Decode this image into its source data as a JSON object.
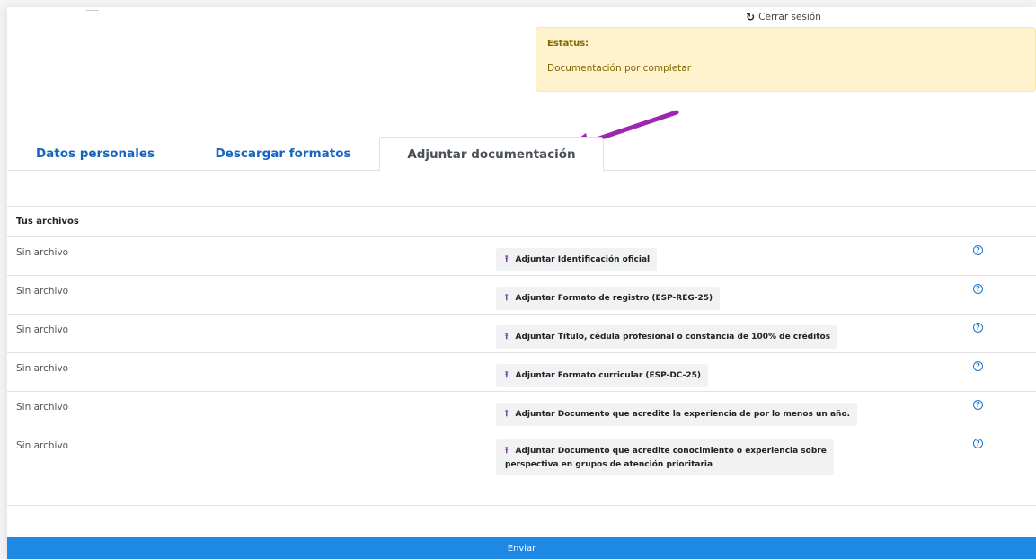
{
  "header": {
    "logout_label": "Cerrar sesión",
    "logout_icon": "logout-icon"
  },
  "status": {
    "title": "Estatus:",
    "value": "Documentación por completar"
  },
  "tabs": [
    {
      "label": "Datos personales",
      "active": false
    },
    {
      "label": "Descargar formatos",
      "active": false
    },
    {
      "label": "Adjuntar documentación",
      "active": true
    }
  ],
  "files": {
    "heading": "Tus archivos",
    "rows": [
      {
        "status": "Sin archivo",
        "button": "Adjuntar Identificación oficial"
      },
      {
        "status": "Sin archivo",
        "button": "Adjuntar Formato de registro (ESP-REG-25)"
      },
      {
        "status": "Sin archivo",
        "button": "Adjuntar Título, cédula profesional o constancia de 100% de créditos"
      },
      {
        "status": "Sin archivo",
        "button": "Adjuntar Formato curricular (ESP-DC-25)"
      },
      {
        "status": "Sin archivo",
        "button": "Adjuntar Documento que acredite la experiencia de por lo menos un año."
      },
      {
        "status": "Sin archivo",
        "button_line1": "Adjuntar Documento que acredite conocimiento o experiencia sobre",
        "button_line2": "perspectiva en grupos de atención prioritaria"
      }
    ]
  },
  "submit_label": "Enviar",
  "colors": {
    "accent": "#1e88e5",
    "tab_link": "#1565c0",
    "status_bg": "#fff3cd",
    "status_text": "#856404",
    "arrow": "#9c27b0",
    "upload_icon": "#7b3fa0"
  }
}
